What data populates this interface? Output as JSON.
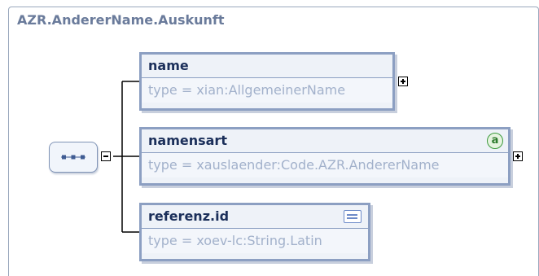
{
  "diagram": {
    "title": "AZR.AndererName.Auskunft",
    "elements": [
      {
        "name": "name",
        "type": "type = xian:AllgemeinerName",
        "has_attribute": false,
        "has_documentation": false,
        "expandable": true
      },
      {
        "name": "namensart",
        "type": "type = xauslaender:Code.AZR.AndererName",
        "has_attribute": true,
        "has_documentation": false,
        "expandable": true
      },
      {
        "name": "referenz.id",
        "type": "type = xoev-lc:String.Latin",
        "has_attribute": false,
        "has_documentation": true,
        "expandable": false
      }
    ],
    "compositor": "sequence",
    "attribute_icon_letter": "a"
  },
  "colors": {
    "accent": "#8c9fc2",
    "header_text": "#1b2f5a",
    "type_text": "#a2b1cb",
    "title_text": "#6a7b9b",
    "attribute_icon": "#3c9a3c"
  }
}
